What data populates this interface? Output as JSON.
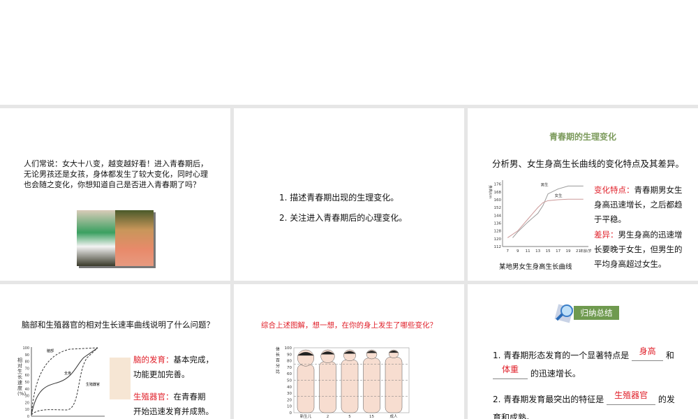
{
  "slide1": {
    "text": "人们常说：女大十八变，越变越好看！进入青春期后，无论男孩还是女孩，身体都发生了较大变化，同时心理也会随之变化，你想知道自己是否进入青春期了吗？"
  },
  "slide2": {
    "items": [
      "1. 描述青春期出现的生理变化。",
      "2. 关注进入青春期后的心理变化。"
    ]
  },
  "slide3": {
    "title": "青春期的生理变化",
    "question": "分析男、女生身高生长曲线的变化特点及其差异。",
    "feature_label": "变化特点：",
    "feature_text": "青春期男女生身高迅速增长，之后都趋于平稳。",
    "diff_label": "差异：",
    "diff_text": "男生身高的迅速增长要晚于女生，但男生的平均身高超过女生。",
    "caption": "某地男女生身高生长曲线"
  },
  "slide4": {
    "question": "脑部和生殖器官的相对生长速率曲线说明了什么问题？",
    "brain_label": "脑的发育：",
    "brain_text": "基本完成，",
    "brain_text2": "功能更加完善。",
    "repro_label": "生殖器官：",
    "repro_text": "在青春期",
    "repro_text2": "开始迅速发育并成熟。",
    "chart_ylabel": "相对生长速度(%)",
    "curves": [
      "脑部",
      "全身",
      "生殖器官"
    ],
    "yticks": [
      "0",
      "10",
      "20",
      "30",
      "40",
      "50",
      "60",
      "70",
      "80",
      "90",
      "100"
    ]
  },
  "slide5": {
    "question": "综合上述图解，想一想，在你的身上发生了哪些变化？",
    "ylabel": "体长百分比",
    "yticks": [
      "0",
      "10",
      "20",
      "30",
      "40",
      "50",
      "60",
      "70",
      "80",
      "90",
      "100"
    ],
    "xlabels": [
      "新生儿",
      "2",
      "5",
      "15",
      "成人"
    ]
  },
  "slide6": {
    "badge": "归纳总结",
    "l1a": "1. 青春期形态发育的一个显著特点是",
    "a1": "身高",
    "l1b": "和",
    "a2": "体重",
    "l1c": "的迅速增长。",
    "l2a": "2. 青春期发育最突出的特征是",
    "a3": "生殖器官",
    "l2b": "的发",
    "l2c": "育和成熟。"
  },
  "chart_data": {
    "type": "line",
    "title": "某地男女生身高生长曲线",
    "xlabel": "年龄/岁",
    "ylabel": "身高/cm",
    "xticks": [
      7,
      9,
      11,
      13,
      15,
      17,
      19,
      21
    ],
    "yticks": [
      112,
      120,
      128,
      136,
      144,
      152,
      160,
      168,
      176
    ],
    "xlim": [
      6,
      23
    ],
    "ylim": [
      112,
      180
    ],
    "series": [
      {
        "name": "男生",
        "x": [
          8,
          9,
          11,
          13,
          14,
          15,
          17,
          19,
          22
        ],
        "y": [
          121,
          127,
          137,
          146,
          154,
          166,
          171,
          174,
          174
        ]
      },
      {
        "name": "女生",
        "x": [
          7,
          9,
          11,
          13,
          14,
          15,
          17,
          19,
          22
        ],
        "y": [
          121,
          128,
          140,
          152,
          157,
          159,
          160,
          160.5,
          160.5
        ]
      }
    ]
  }
}
